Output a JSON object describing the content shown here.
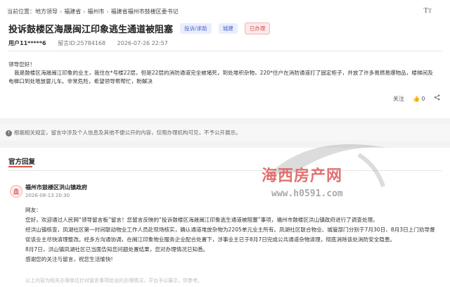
{
  "breadcrumb": {
    "label": "当前位置：",
    "items": [
      "地方领导",
      "福建省",
      "福州市",
      "福建省福州市鼓楼区委书记"
    ]
  },
  "header": {
    "font_icon": "font-size-icon",
    "title": "投诉鼓楼区海晟闽江印象逃生通道被阻塞",
    "tags": {
      "type": "投诉/求助",
      "field": "城建",
      "status": "已办理"
    },
    "colors": {
      "accent": "#d9534f",
      "tag_blue": "#4a67c7"
    }
  },
  "meta": {
    "user": "用户11*****6",
    "message_id": "留言ID:25784168",
    "datetime": "2026-07-26 22:57"
  },
  "message": {
    "greeting": "领导您好！",
    "body": "我是鼓楼区海晟闽江印象的业主，我住在*号楼22层，但是22层的消防通道完全被堵死，到处堆积杂物，220*住户在消防通道打了固定柜子，并放了许多易燃易爆物品，楼梯间及电梯口到处堆放婴儿车。非常危险，希望领导帮帮忙，盼解决"
  },
  "actions": {
    "follow": "关注",
    "like_count": "0",
    "share_icon": "share-icon"
  },
  "notice": {
    "text": "根据相关规定，留言中涉及个人信息及其他不便公开的内容，仅限办理机构可见，不予公开展示。"
  },
  "official_reply": {
    "section_title": "官方回复",
    "org": "福州市鼓楼区洪山镇政府",
    "time": "2026-08-13 20:30",
    "salutation": "网友：",
    "p1": "您好，欢迎通过人民网“领导留言板”留言！您留言反映的“投诉鼓楼区海晟闽江印象逃生通道被阻塞”事项，福州市鼓楼区洪山镇政府进行了调查处理。",
    "p2": "经洪山镇核查，凤湖社区第一时间联动物业工作人员赴现场核实，确认通道堆放杂物为2205单元业主所有。凤湖社区联合物业、城管部门分别于7月30日、8月3日上门劝导督促该业主尽快清理整改。经多方沟通协调，在闽江印象物业服务企业配合处置下，涉事业主已于8月7日完成公共通道杂物清理，彻底消除该处消防安全隐患。",
    "p3": "8月7日，洪山镇凤湖社区已当面告知您问题处置结果，您对办理情况已知悉。",
    "p4": "感谢您的关注与留言，祝您生活愉快!",
    "footer": "以上内容为相关办理单位针对留言事项给出的办理情况，平台予以展示，供参考。"
  },
  "watermark": {
    "text": "海西房产网",
    "url": "www.h0591.com"
  }
}
